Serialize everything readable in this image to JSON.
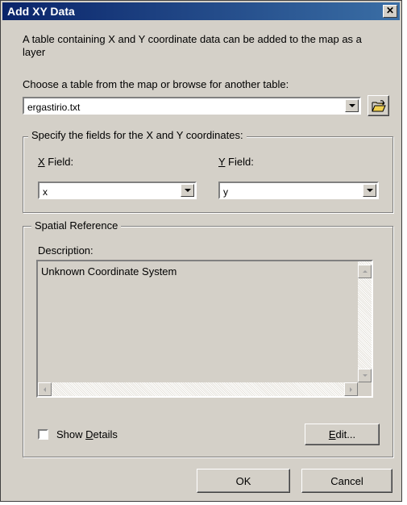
{
  "window": {
    "title": "Add XY Data",
    "close_glyph": "✕"
  },
  "intro_text": "A table containing X and Y coordinate data can be added to the map as a layer",
  "table_prompt": "Choose a table from the map or browse for another table:",
  "table_select": {
    "value": "ergastirio.txt"
  },
  "coords_group": {
    "label": "Specify the fields for the X and Y coordinates:",
    "x_label_key": "X",
    "x_label_rest": " Field:",
    "y_label_key": "Y",
    "y_label_rest": " Field:",
    "x_value": "x",
    "y_value": "y"
  },
  "spatial_group": {
    "label": "Spatial Reference",
    "description_label": "Description:",
    "description_text": "Unknown Coordinate System",
    "show_details_prefix": "Show ",
    "show_details_key": "D",
    "show_details_rest": "etails",
    "show_details_checked": false,
    "edit_key": "E",
    "edit_rest": "dit..."
  },
  "buttons": {
    "ok": "OK",
    "cancel": "Cancel"
  },
  "colors": {
    "titlebar_start": "#0a246a",
    "titlebar_end": "#3a6ea5",
    "face": "#d4d0c8"
  },
  "icons": {
    "browse": "folder-open-icon",
    "dropdown": "chevron-down-icon"
  }
}
